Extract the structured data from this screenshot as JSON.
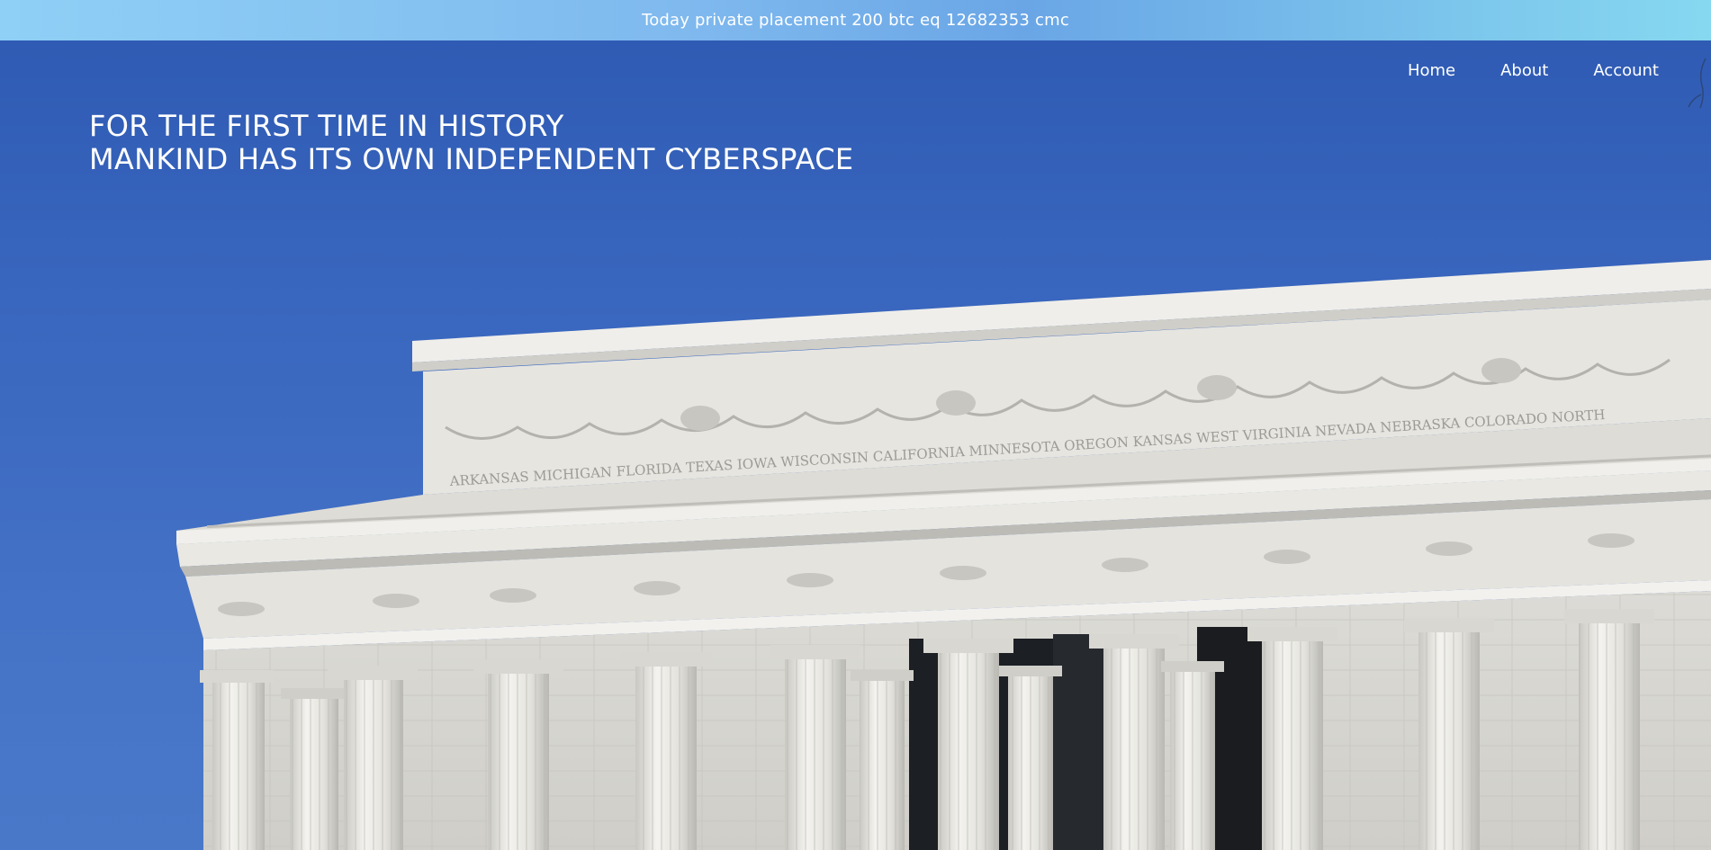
{
  "announcement": {
    "text": "Today private placement 200 btc eq 12682353 cmc"
  },
  "nav": {
    "items": [
      {
        "label": "Home"
      },
      {
        "label": "About"
      },
      {
        "label": "Account"
      }
    ]
  },
  "hero": {
    "headline_line1": "FOR THE FIRST TIME IN HISTORY",
    "headline_line2": "MANKIND HAS ITS OWN INDEPENDENT CYBERSPACE",
    "image": "lincoln-memorial-photo",
    "frieze_states": [
      "ARKANSAS",
      "MICHIGAN",
      "FLORIDA",
      "TEXAS",
      "IOWA",
      "WISCONSIN",
      "CALIFORNIA",
      "MINNESOTA",
      "OREGON",
      "KANSAS",
      "WEST VIRGINIA",
      "NEVADA",
      "NEBRASKA",
      "COLORADO",
      "NORTH"
    ]
  },
  "colors": {
    "sky": "#3a67bf",
    "marble": "#e9e8e3",
    "announce_gradient_start": "#8fd0f6",
    "announce_gradient_end": "#86d8f0"
  }
}
